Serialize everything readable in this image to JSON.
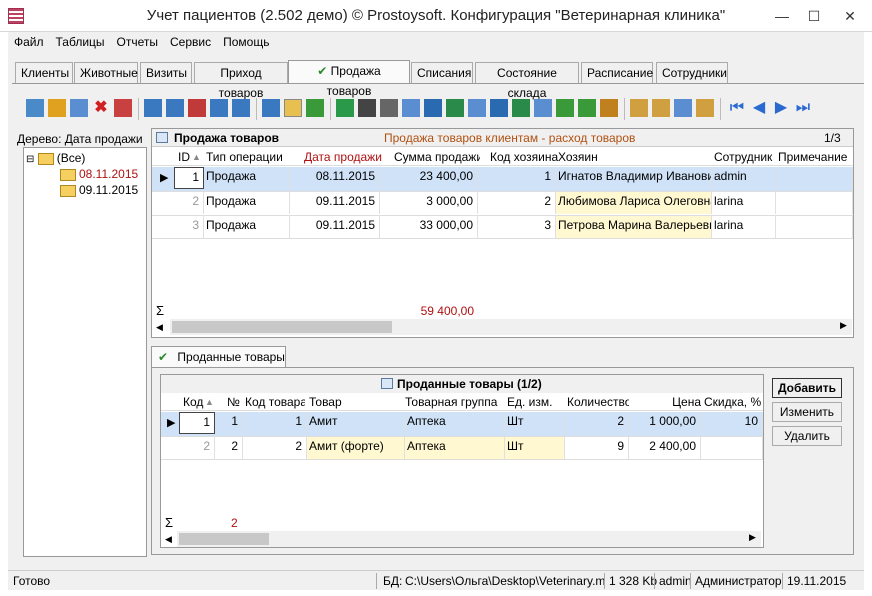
{
  "window": {
    "title": "Учет пациентов (2.502 демо) © Prostoysoft. Конфигурация \"Ветеринарная клиника\"",
    "minimize": "—",
    "maximize": "☐",
    "close": "✕"
  },
  "menu": [
    "Файл",
    "Таблицы",
    "Отчеты",
    "Сервис",
    "Помощь"
  ],
  "tabs": [
    "Клиенты",
    "Животные",
    "Визиты",
    "Приход товаров",
    "Продажа товаров",
    "Списания",
    "Состояние склада",
    "Расписание",
    "Сотрудники"
  ],
  "active_tab": "Продажа товаров",
  "tree": {
    "header": "Дерево: Дата продажи",
    "root": "(Все)",
    "items": [
      "08.11.2015",
      "09.11.2015"
    ]
  },
  "top_panel": {
    "title": "Продажа товаров",
    "subtitle": "Продажа товаров клиентам - расход товаров",
    "pager": "1/3",
    "columns": [
      "ID",
      "Тип операции",
      "Дата продажи",
      "Сумма продажи",
      "Код хозяина",
      "Хозяин",
      "Сотрудник",
      "Примечание"
    ],
    "rows": [
      [
        "1",
        "Продажа",
        "08.11.2015",
        "23 400,00",
        "1",
        "Игнатов Владимир Иванович",
        "admin",
        ""
      ],
      [
        "2",
        "Продажа",
        "09.11.2015",
        "3 000,00",
        "2",
        "Любимова Лариса Олеговна",
        "larina",
        ""
      ],
      [
        "3",
        "Продажа",
        "09.11.2015",
        "33 000,00",
        "3",
        "Петрова Марина Валерьевна",
        "larina",
        ""
      ]
    ],
    "sigma": "Σ",
    "total": "59 400,00"
  },
  "sub_tab": "Проданные товары",
  "bottom_panel": {
    "title": "Проданные товары (1/2)",
    "columns": [
      "Код",
      "№",
      "Код товара",
      "Товар",
      "Товарная группа",
      "Ед. изм.",
      "Количество",
      "Цена",
      "Скидка, %"
    ],
    "rows": [
      [
        "1",
        "1",
        "1",
        "Амит",
        "Аптека",
        "Шт",
        "2",
        "1 000,00",
        "10"
      ],
      [
        "2",
        "2",
        "2",
        "Амит (форте)",
        "Аптека",
        "Шт",
        "9",
        "2 400,00",
        ""
      ]
    ],
    "sigma": "Σ",
    "count": "2",
    "buttons": {
      "add": "Добавить",
      "edit": "Изменить",
      "delete": "Удалить"
    }
  },
  "status": {
    "ready": "Готово",
    "db_label": "БД:",
    "db_path": "C:\\Users\\Ольга\\Desktop\\Veterinary.mdb",
    "size": "1 328 Kb",
    "user": "admin",
    "role": "Администратор",
    "date": "19.11.2015"
  },
  "colors": {
    "selected": "#cfe2f7",
    "highlight": "#fff8d0",
    "accent_red": "#b01010",
    "date_header": "#b01010"
  }
}
